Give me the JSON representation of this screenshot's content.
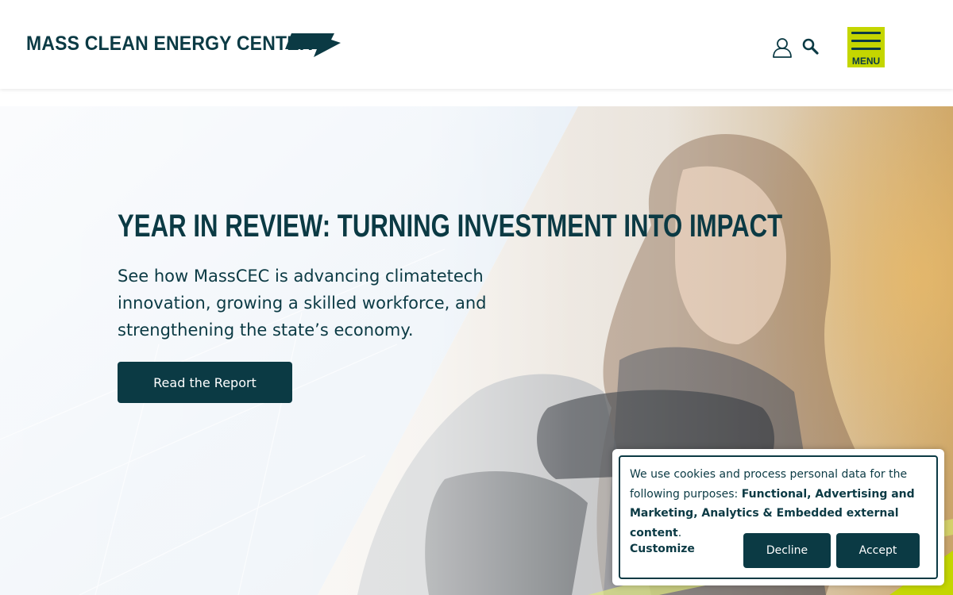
{
  "header": {
    "logo_text": "MASS CLEAN ENERGY CENTER",
    "menu_label": "MENU",
    "icons": [
      "user-icon",
      "search-icon",
      "hamburger-icon"
    ]
  },
  "hero": {
    "title": "YEAR IN REVIEW: TURNING INVESTMENT INTO IMPACT",
    "subtitle": "See how MassCEC is advancing climatetech innovation, growing a skilled workforce, and strengthening the state’s economy.",
    "button_label": "Read the Report"
  },
  "cookie_banner": {
    "text_prefix": "We use cookies and process personal data for the following purposes: ",
    "text_bold": "Functional, Advertising and Marketing, Analytics & Embedded external content",
    "text_suffix": ".",
    "customize_label": "Customize",
    "decline_label": "Decline",
    "accept_label": "Accept"
  },
  "colors": {
    "brand_dark": "#0b3a44",
    "accent_lime": "#c4d600",
    "background": "#ffffff"
  }
}
